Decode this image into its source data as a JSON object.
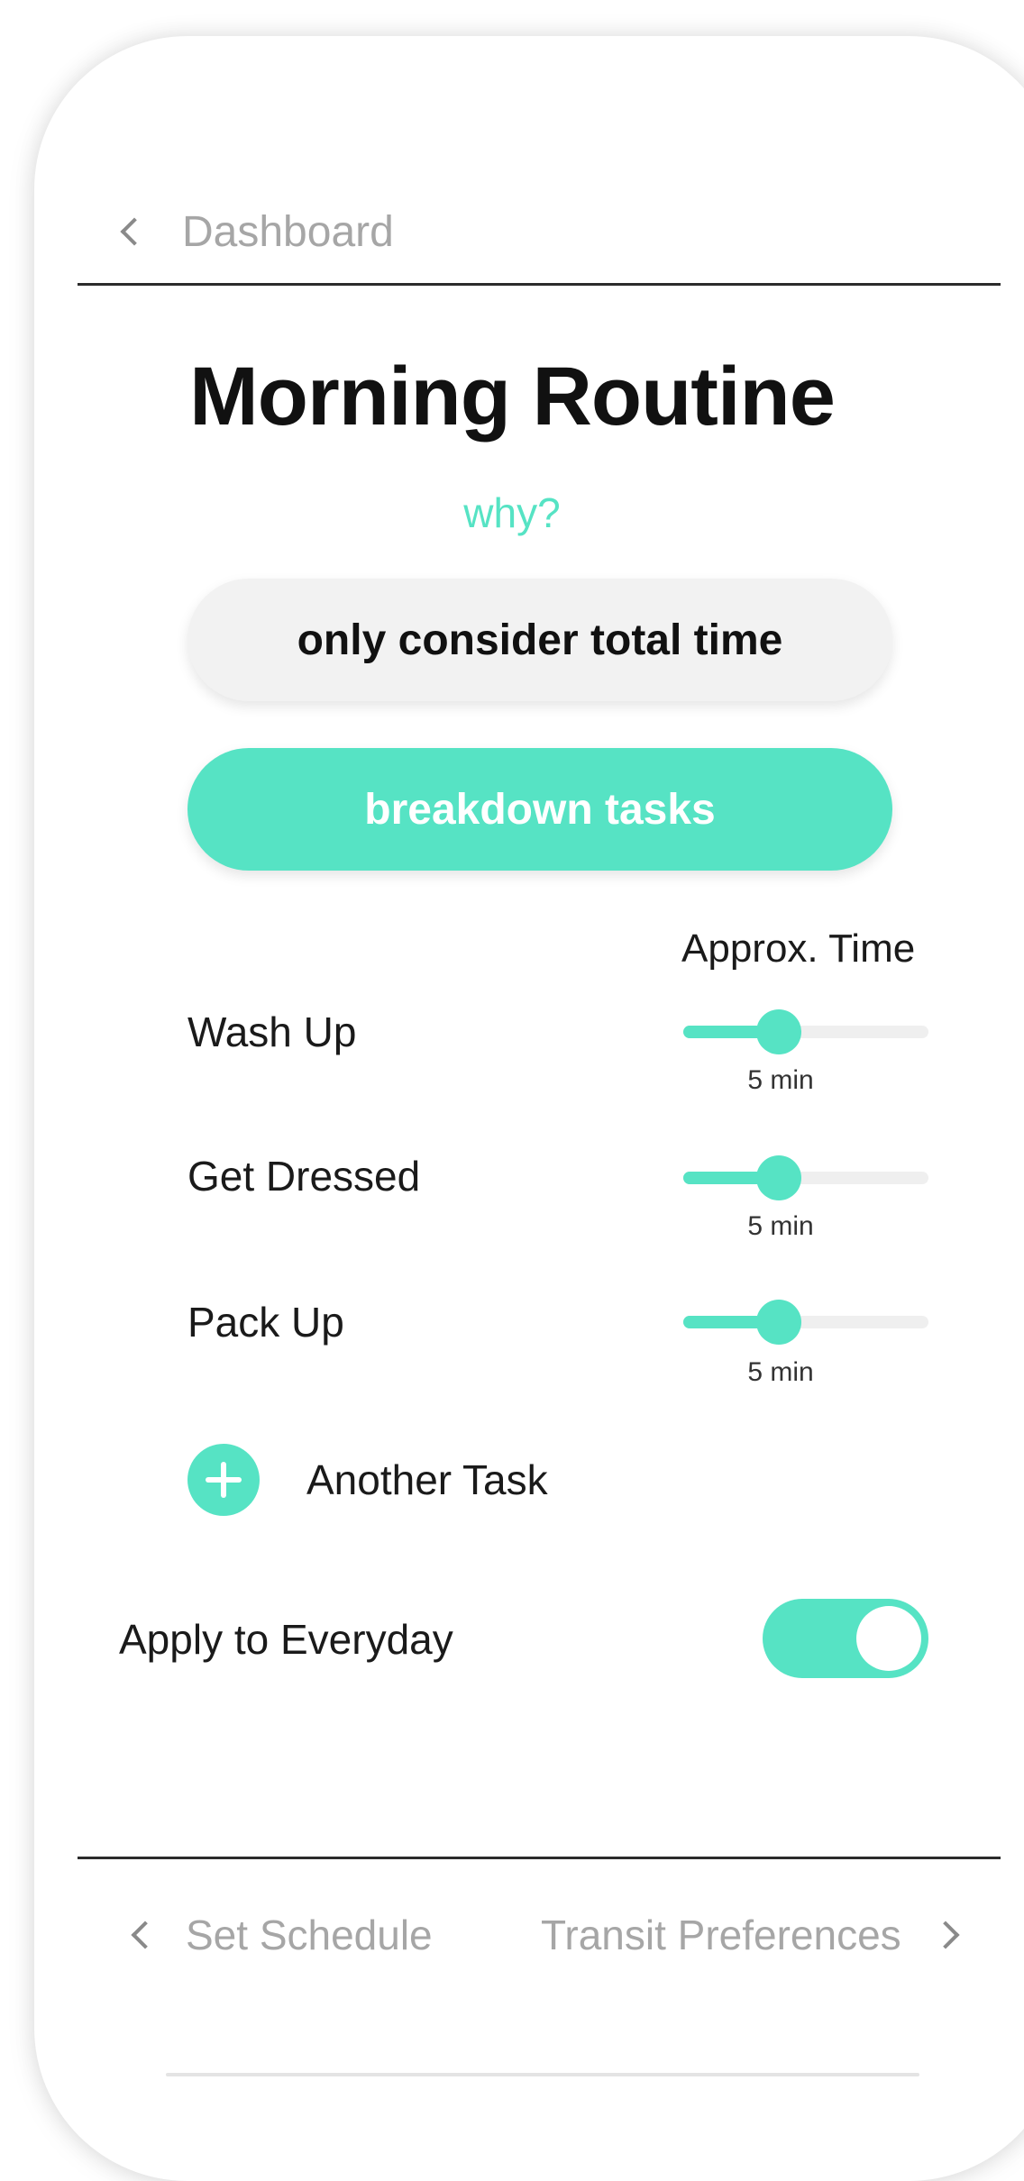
{
  "header": {
    "back_label": "Dashboard"
  },
  "page": {
    "title": "Morning Routine",
    "why_link": "why?"
  },
  "mode_buttons": {
    "total_time_label": "only consider total time",
    "breakdown_label": "breakdown tasks",
    "selected": "breakdown tasks"
  },
  "tasks": {
    "column_header": "Approx. Time",
    "items": [
      {
        "label": "Wash Up",
        "time_label": "5 min",
        "slider_level": 0.39
      },
      {
        "label": "Get Dressed",
        "time_label": "5 min",
        "slider_level": 0.39
      },
      {
        "label": "Pack Up",
        "time_label": "5 min",
        "slider_level": 0.39
      }
    ],
    "add_label": "Another Task"
  },
  "everyday": {
    "label": "Apply to Everyday",
    "enabled": true
  },
  "footer": {
    "prev_label": "Set Schedule",
    "next_label": "Transit Preferences"
  },
  "colors": {
    "accent": "#56e3c4",
    "muted_text": "#a6a6a6",
    "secondary_button": "#f2f2f2"
  }
}
